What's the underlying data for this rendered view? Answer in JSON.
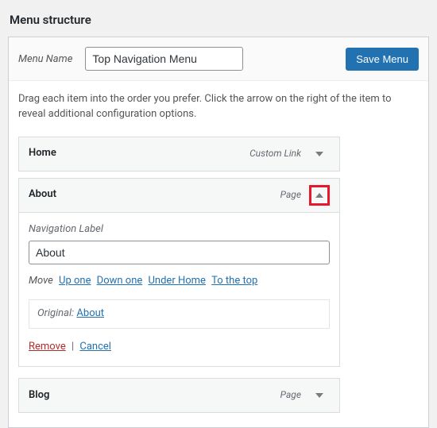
{
  "section_title": "Menu structure",
  "menu_name": {
    "label": "Menu Name",
    "value": "Top Navigation Menu"
  },
  "save_button": "Save Menu",
  "instruction": "Drag each item into the order you prefer. Click the arrow on the right of the item to reveal additional configuration options.",
  "items": {
    "home": {
      "title": "Home",
      "type": "Custom Link"
    },
    "about": {
      "title": "About",
      "type": "Page"
    },
    "blog": {
      "title": "Blog",
      "type": "Page"
    }
  },
  "about_settings": {
    "nav_label_field": "Navigation Label",
    "nav_label_value": "About",
    "move_label": "Move",
    "move_up": "Up one",
    "move_down": "Down one",
    "move_under": "Under Home",
    "move_top": "To the top",
    "original_label": "Original:",
    "original_link": "About",
    "remove": "Remove",
    "cancel": "Cancel"
  }
}
